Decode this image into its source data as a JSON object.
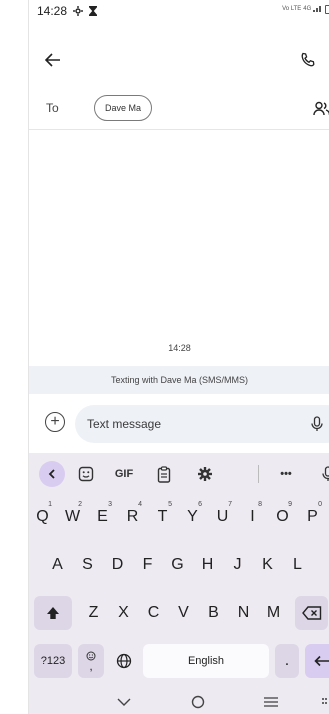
{
  "status_bar": {
    "time": "14:28",
    "network": "Vo LTE",
    "signal_label": "4G",
    "battery": "70"
  },
  "to_row": {
    "label": "To",
    "recipient": "Dave Ma"
  },
  "conversation": {
    "timestamp": "14:28",
    "info": "Texting with Dave Ma (SMS/MMS)"
  },
  "compose": {
    "placeholder": "Text message"
  },
  "keyboard": {
    "toolbar": {
      "gif": "GIF",
      "more": "•••"
    },
    "row1": [
      {
        "k": "Q",
        "s": "1"
      },
      {
        "k": "W",
        "s": "2"
      },
      {
        "k": "E",
        "s": "3"
      },
      {
        "k": "R",
        "s": "4"
      },
      {
        "k": "T",
        "s": "5"
      },
      {
        "k": "Y",
        "s": "6"
      },
      {
        "k": "U",
        "s": "7"
      },
      {
        "k": "I",
        "s": "8"
      },
      {
        "k": "O",
        "s": "9"
      },
      {
        "k": "P",
        "s": "0"
      }
    ],
    "row2": [
      "A",
      "S",
      "D",
      "F",
      "G",
      "H",
      "J",
      "K",
      "L"
    ],
    "row3": [
      "Z",
      "X",
      "C",
      "V",
      "B",
      "N",
      "M"
    ],
    "symbols_key": "?123",
    "comma_key": ",",
    "space_key": "English",
    "period_key": "."
  },
  "colors": {
    "keyboard_bg": "#eeeaf2",
    "accent": "#d8ccf0",
    "input_bg": "#eef1f6"
  }
}
